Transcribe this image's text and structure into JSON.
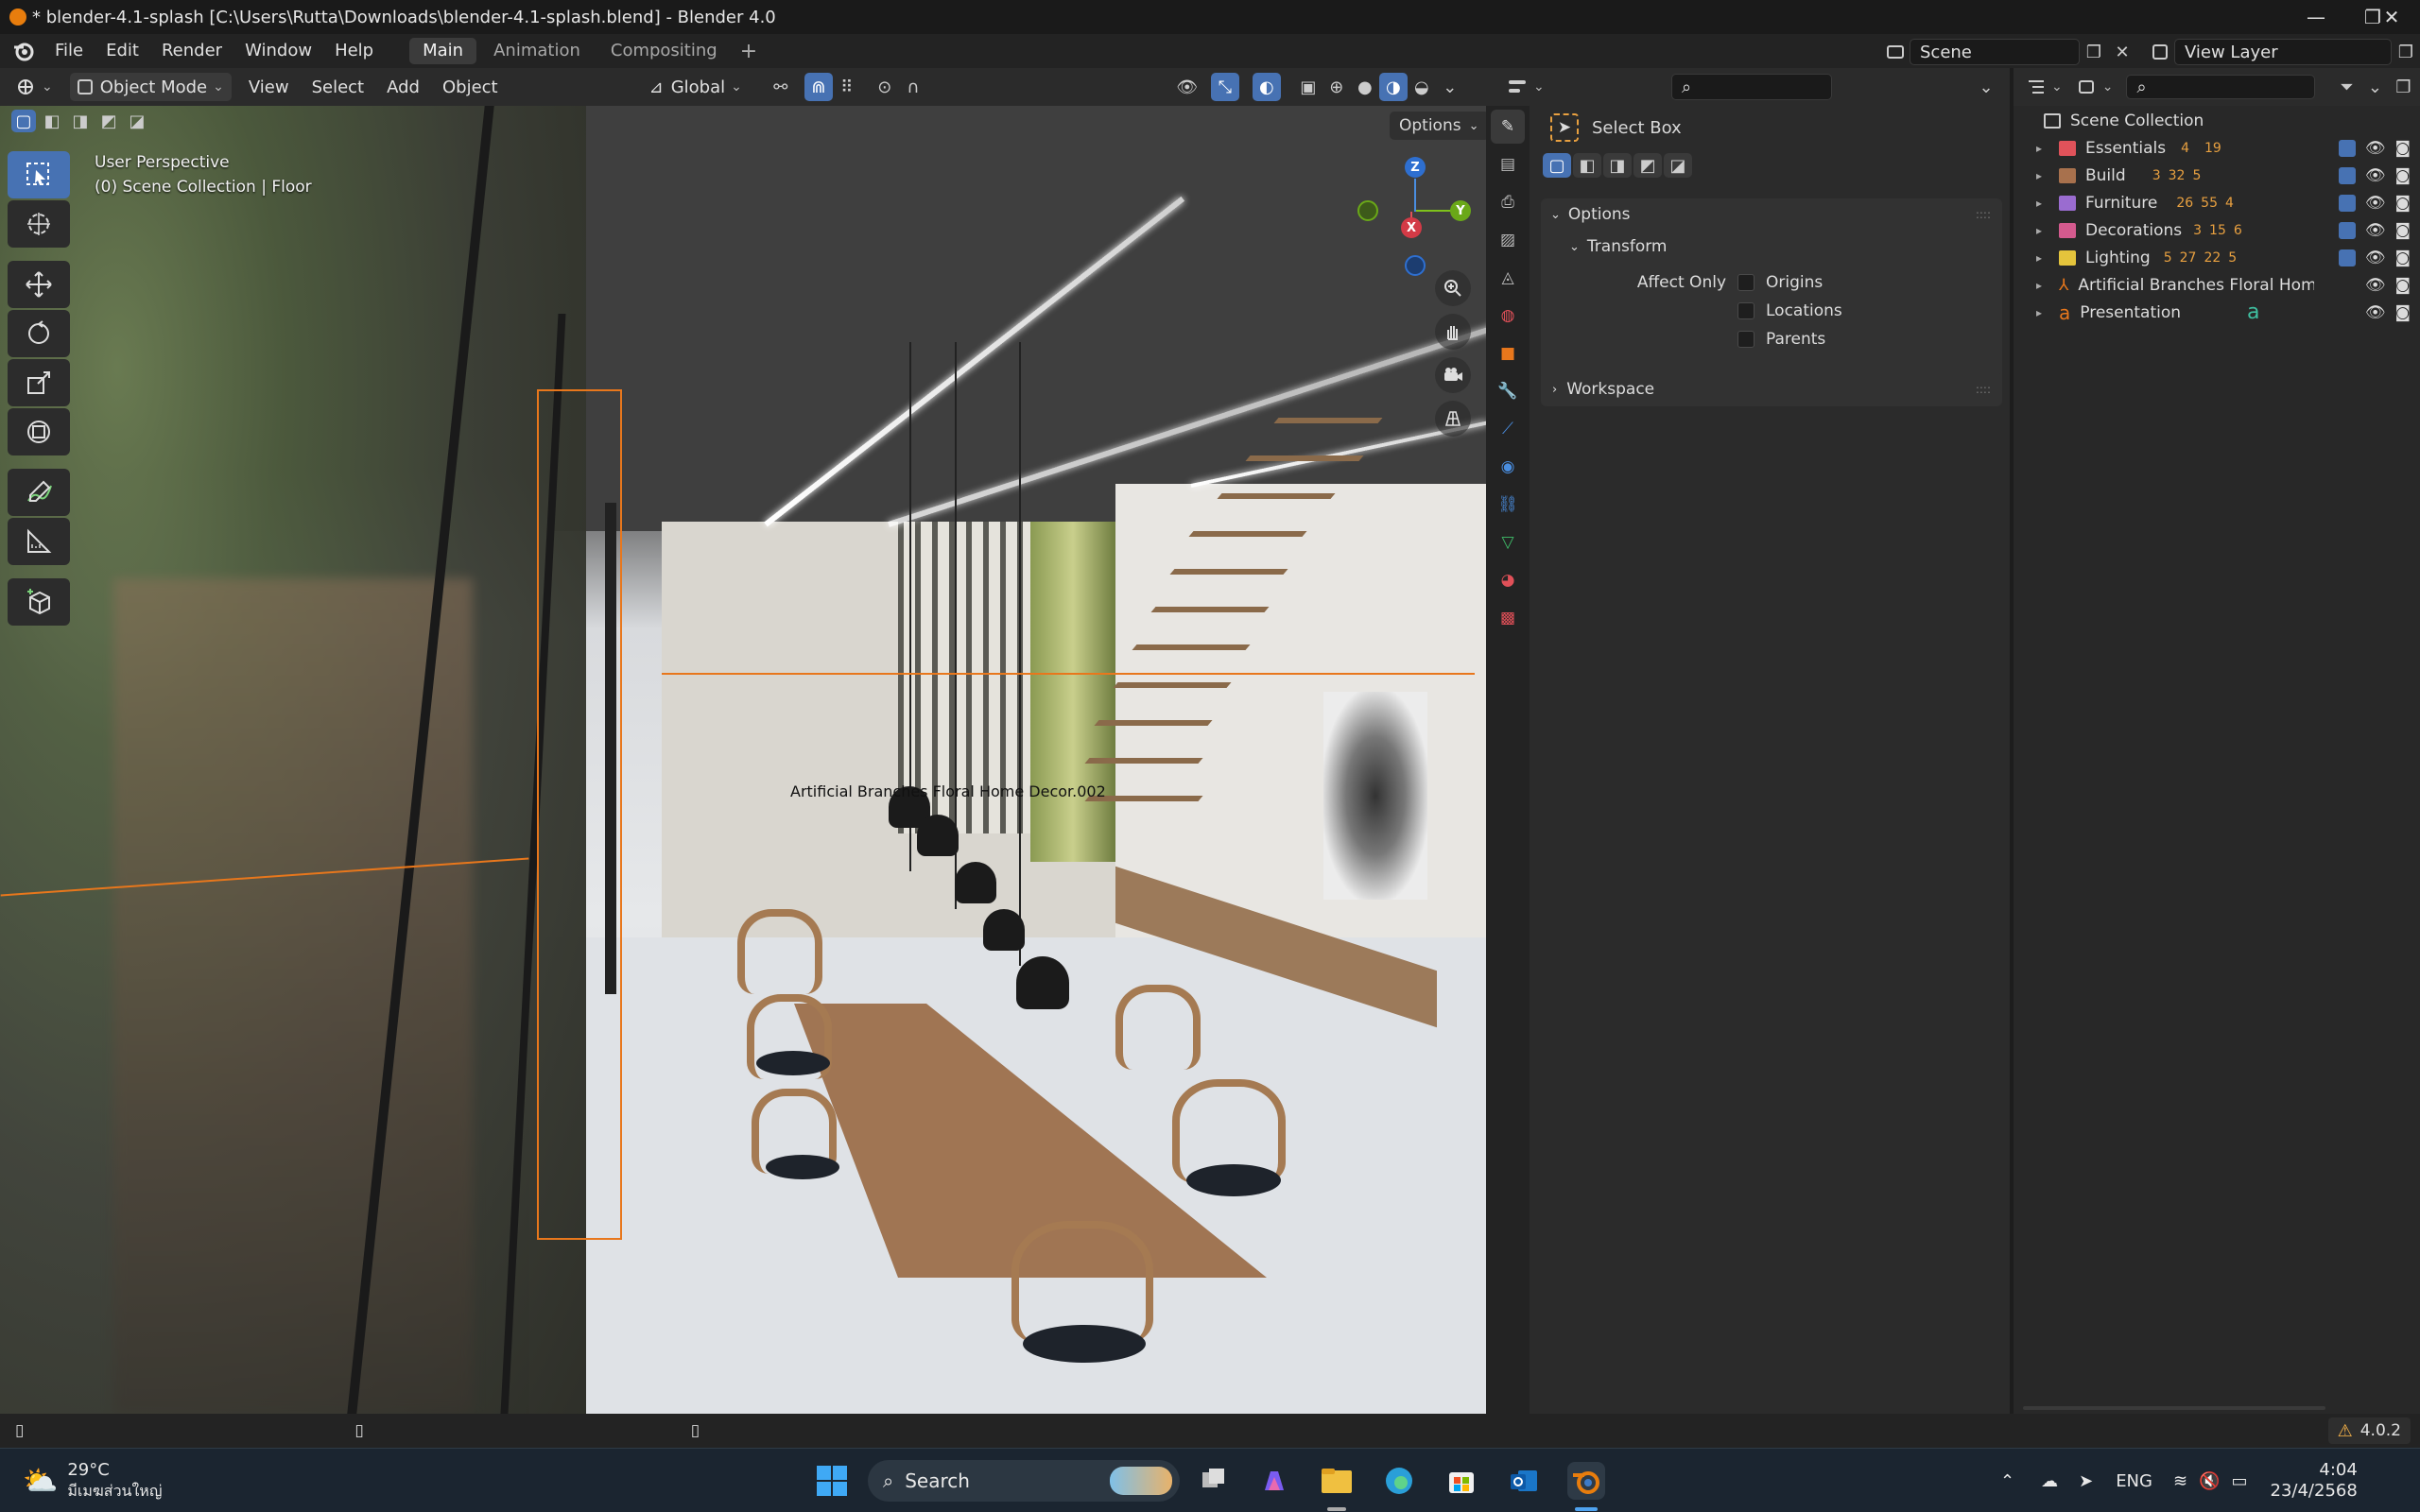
{
  "window": {
    "title": "* blender-4.1-splash [C:\\Users\\Rutta\\Downloads\\blender-4.1-splash.blend] - Blender 4.0",
    "minimize": "—",
    "maximize": "❐",
    "close": "✕"
  },
  "menubar": {
    "items": [
      "File",
      "Edit",
      "Render",
      "Window",
      "Help"
    ],
    "workspaces": [
      "Main",
      "Animation",
      "Compositing"
    ],
    "active_workspace": "Main",
    "add_workspace": "+",
    "scene_label": "Scene",
    "view_layer_label": "View Layer"
  },
  "viewport_header": {
    "mode": "Object Mode",
    "menus": [
      "View",
      "Select",
      "Add",
      "Object"
    ],
    "transform_orientation": "Global",
    "options_label": "Options"
  },
  "viewport": {
    "perspective": "User Perspective",
    "collection_info": "(0) Scene Collection | Floor",
    "object_label": "Artificial Branches Floral Home Decor.002",
    "gizmo": {
      "x": "X",
      "y": "Y",
      "z": "Z"
    }
  },
  "properties": {
    "tool_name": "Select Box",
    "options_header": "Options",
    "transform_header": "Transform",
    "affect_only_label": "Affect Only",
    "checkboxes": [
      {
        "label": "Origins",
        "checked": false
      },
      {
        "label": "Locations",
        "checked": false
      },
      {
        "label": "Parents",
        "checked": false
      }
    ],
    "workspace_header": "Workspace",
    "panel_grip": "::::"
  },
  "outliner": {
    "root": "Scene Collection",
    "items": [
      {
        "name": "Essentials",
        "color": "#e0525a",
        "badges": [
          "4",
          "19"
        ]
      },
      {
        "name": "Build",
        "color": "#a8714d",
        "badges": [
          "3",
          "32",
          "5"
        ]
      },
      {
        "name": "Furniture",
        "color": "#9a6cd0",
        "badges": [
          "26",
          "55",
          "4"
        ]
      },
      {
        "name": "Decorations",
        "color": "#d45a8e",
        "badges": [
          "3",
          "15",
          "6"
        ]
      },
      {
        "name": "Lighting",
        "color": "#e4c43c",
        "badges": [
          "5",
          "27",
          "22",
          "5"
        ]
      },
      {
        "name": "Artificial Branches Floral Home",
        "color": "#e8771c",
        "badges": []
      },
      {
        "name": "Presentation",
        "color": "#e8771c",
        "badges": []
      }
    ]
  },
  "statusbar": {
    "version": "4.0.2"
  },
  "taskbar": {
    "weather_temp": "29°C",
    "weather_desc": "มีเมฆส่วนใหญ่",
    "search_placeholder": "Search",
    "language": "ENG",
    "time": "4:04",
    "date": "23/4/2568"
  },
  "colors": {
    "accent": "#4772b3",
    "selection": "#e8771c",
    "blender_orange": "#e87d0d"
  }
}
